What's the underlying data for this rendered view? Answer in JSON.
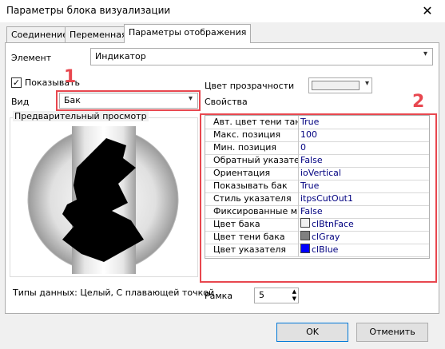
{
  "window": {
    "title": "Параметры блока визуализации",
    "close_glyph": "✕"
  },
  "tabs": [
    {
      "label": "Соединение"
    },
    {
      "label": "Переменная"
    },
    {
      "label": "Параметры отображения"
    }
  ],
  "element": {
    "label": "Элемент",
    "value": "Индикатор"
  },
  "show": {
    "label": "Показывать",
    "checked_glyph": "✓"
  },
  "view": {
    "label": "Вид",
    "value": "Бак"
  },
  "transparency": {
    "label": "Цвет прозрачности"
  },
  "properties": {
    "label": "Свойства",
    "rows": [
      {
        "key": "Авт. цвет тени танк",
        "value": "True"
      },
      {
        "key": "Макс. позиция",
        "value": "100"
      },
      {
        "key": "Мин. позиция",
        "value": "0"
      },
      {
        "key": "Обратный указатель",
        "value": "False"
      },
      {
        "key": "Ориентация",
        "value": "ioVertical"
      },
      {
        "key": "Показывать бак",
        "value": "True"
      },
      {
        "key": "Стиль указателя",
        "value": "itpsCutOut1"
      },
      {
        "key": "Фиксированные ми",
        "value": "False"
      },
      {
        "key": "Цвет бака",
        "value": "clBtnFace",
        "color": "#f0f0f0"
      },
      {
        "key": "Цвет тени бака",
        "value": "clGray",
        "color": "#808080"
      },
      {
        "key": "Цвет указателя",
        "value": "clBlue",
        "color": "#0000ff"
      }
    ]
  },
  "preview": {
    "label": "Предварительный просмотр"
  },
  "data_types": "Типы данных: Целый, С плавающей точкой",
  "frame": {
    "label": "Рамка",
    "value": "5"
  },
  "buttons": {
    "ok": "OK",
    "cancel": "Отменить"
  },
  "annotations": {
    "one": "1",
    "two": "2"
  },
  "colors": {
    "accent_red": "#e8474f",
    "button_border_focus": "#0078d7"
  }
}
